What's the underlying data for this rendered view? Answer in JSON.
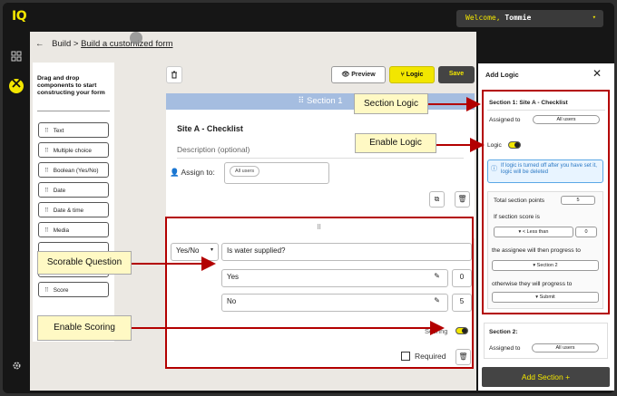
{
  "app": {
    "logo": "IQ",
    "welcome_prefix": "Welcome,",
    "user": "Tommie",
    "caret": "▾"
  },
  "breadcrumb": {
    "back_arrow": "←",
    "parent": "Build",
    "sep": ">",
    "current": "Build a customized form"
  },
  "palette": {
    "hint": "Drag and drop components to start constructing your form",
    "items": [
      {
        "label": "Text"
      },
      {
        "label": "Multiple choice"
      },
      {
        "label": "Boolean (Yes/No)"
      },
      {
        "label": "Date"
      },
      {
        "label": "Date & time"
      },
      {
        "label": "Media"
      },
      {
        "label": ""
      },
      {
        "label": ""
      },
      {
        "label": "Score"
      }
    ]
  },
  "toolbar": {
    "delete_icon": "trash-icon",
    "preview": "Preview",
    "logic": "Logic",
    "save": "Save"
  },
  "section1": {
    "header": "Section 1",
    "title": "Site A - Checklist",
    "description_placeholder": "Description (optional)",
    "assign_label": "Assign to:",
    "assign_value": "All users"
  },
  "question": {
    "drag_handle": "⠿",
    "type": "Yes/No",
    "text": "Is water supplied?",
    "options": [
      {
        "label": "Yes",
        "score": "0"
      },
      {
        "label": "No",
        "score": "5"
      }
    ],
    "scoring_label": "Scoring",
    "required_label": "Required"
  },
  "right_panel": {
    "title": "Add Logic",
    "close": "✕",
    "section1_title": "Section 1: Site A - Checklist",
    "assigned_to": "Assigned to",
    "assigned_value": "All users",
    "logic_label": "Logic",
    "info": "If logic is turned off after you have set it, logic will be deleted",
    "total_points_label": "Total section points",
    "total_points": "5",
    "if_score": "If section score is",
    "comparator": "Less than",
    "threshold": "0",
    "then_text": "the assignee will then progress to",
    "then_target": "Section 2",
    "otherwise_text": "otherwise they will progress to",
    "otherwise_target": "Submit",
    "section2_title": "Section 2:",
    "section2_assigned": "Assigned to",
    "section2_value": "All users",
    "add_section": "Add Section  +"
  },
  "callouts": {
    "section_logic": "Section Logic",
    "enable_logic": "Enable Logic",
    "scorable_question": "Scorable Question",
    "enable_scoring": "Enable Scoring"
  },
  "colors": {
    "accent": "#f2e600",
    "annotation_red": "#b30000",
    "section_header": "#a5bde0",
    "callout_bg": "#fff9c4"
  }
}
